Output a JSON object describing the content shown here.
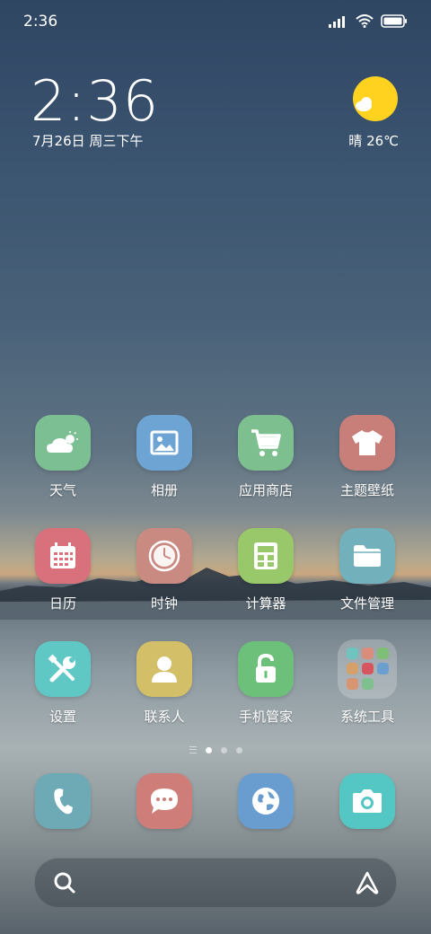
{
  "status_bar": {
    "time": "2:36",
    "icons": [
      "signal-icon",
      "wifi-icon",
      "battery-icon"
    ]
  },
  "clock_widget": {
    "time": "2:36",
    "date": "7月26日 周三下午"
  },
  "weather_widget": {
    "text": "晴 26℃",
    "icon": "sunny-cloud-icon"
  },
  "apps": [
    {
      "label": "天气",
      "icon": "weather-icon",
      "color": "#7cbf93"
    },
    {
      "label": "相册",
      "icon": "gallery-icon",
      "color": "#6ea4d3"
    },
    {
      "label": "应用商店",
      "icon": "cart-icon",
      "color": "#7dbf8f"
    },
    {
      "label": "主题壁纸",
      "icon": "tshirt-icon",
      "color": "#c97f79"
    },
    {
      "label": "日历",
      "icon": "calendar-icon",
      "color": "#d8717b"
    },
    {
      "label": "时钟",
      "icon": "clock-icon",
      "color": "#c98a82"
    },
    {
      "label": "计算器",
      "icon": "calculator-icon",
      "color": "#98c86a"
    },
    {
      "label": "文件管理",
      "icon": "folder-icon",
      "color": "#72b0bb"
    },
    {
      "label": "设置",
      "icon": "wrench-screwdriver-icon",
      "color": "#5fc7c4"
    },
    {
      "label": "联系人",
      "icon": "contact-icon",
      "color": "#d3bf67"
    },
    {
      "label": "手机管家",
      "icon": "unlock-icon",
      "color": "#6cc079"
    },
    {
      "label": "系统工具",
      "icon": "folder-grid-icon",
      "color": "#ffffff"
    }
  ],
  "dock": [
    {
      "icon": "phone-icon",
      "color": "#6ea9b6"
    },
    {
      "icon": "message-icon",
      "color": "#cf7d78"
    },
    {
      "icon": "browser-icon",
      "color": "#6a9dcf"
    },
    {
      "icon": "camera-icon",
      "color": "#54c6c3"
    }
  ],
  "page_indicator": {
    "pages": 3,
    "current": 0
  }
}
